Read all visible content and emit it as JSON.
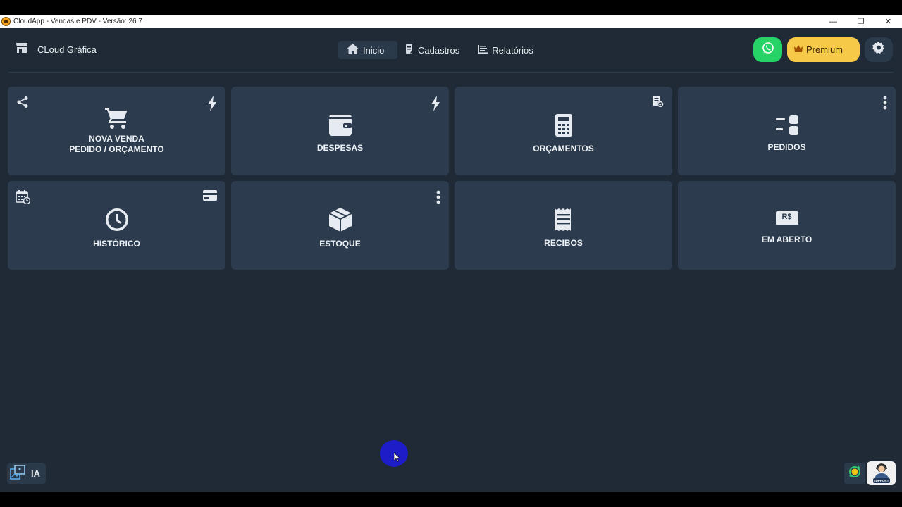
{
  "window": {
    "title": "CloudApp - Vendas e PDV - Versão: 26.7",
    "minimize_glyph": "—",
    "maximize_glyph": "❐",
    "close_glyph": "✕"
  },
  "header": {
    "brand_label": "CLoud Gráfica",
    "nav": [
      {
        "label": "Inicio",
        "icon": "home-icon",
        "active": true
      },
      {
        "label": "Cadastros",
        "icon": "edit-document-icon",
        "active": false
      },
      {
        "label": "Relatórios",
        "icon": "list-icon",
        "active": false
      }
    ],
    "premium_label": "Premium"
  },
  "cards": [
    {
      "line1": "NOVA VENDA",
      "line2": "PEDIDO / ORÇAMENTO",
      "icon": "cart-icon",
      "left_icon": "share-icon",
      "right_icon": "bolt-icon"
    },
    {
      "line1": "DESPESAS",
      "line2": "",
      "icon": "wallet-icon",
      "right_icon": "bolt-icon"
    },
    {
      "line1": "ORÇAMENTOS",
      "line2": "",
      "icon": "calculator-icon",
      "right_icon": "document-check-icon"
    },
    {
      "line1": "PEDIDOS",
      "line2": "",
      "icon": "orders-icon",
      "right_icon": "more-vertical-icon"
    },
    {
      "line1": "HISTÓRICO",
      "line2": "",
      "icon": "clock-icon",
      "left_icon": "calendar-icon",
      "right_icon": "credit-card-icon"
    },
    {
      "line1": "ESTOQUE",
      "line2": "",
      "icon": "box-icon",
      "right_icon": "more-vertical-icon"
    },
    {
      "line1": "RECIBOS",
      "line2": "",
      "icon": "receipt-icon"
    },
    {
      "line1": "EM ABERTO",
      "line2": "",
      "icon": "money-icon",
      "money_text": "R$"
    }
  ],
  "footer": {
    "ia_label": "IA",
    "support_label": "SUPPORT"
  },
  "colors": {
    "background": "#1f2a36",
    "card": "#2c3c4e",
    "whatsapp": "#25d366",
    "premium": "#f7c948"
  }
}
